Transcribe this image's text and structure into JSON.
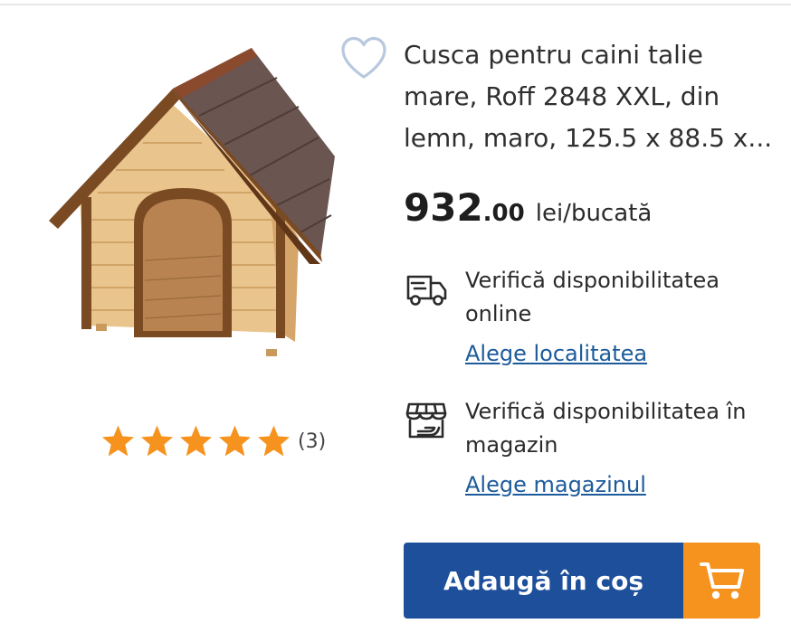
{
  "product": {
    "title": "Cusca pentru caini talie mare, Roff 2848 XXL, din lemn, maro, 125.5 x 88.5 x...",
    "image_icon": "dog-house-image",
    "rating": {
      "stars": 5,
      "max": 5,
      "count_label": "(3)"
    },
    "price": {
      "integer": "932",
      "decimals": ".00",
      "unit": "lei/bucată"
    }
  },
  "availability": {
    "online": {
      "icon": "delivery-truck-icon",
      "text": "Verifică disponibilitatea online",
      "link": "Alege localitatea"
    },
    "store": {
      "icon": "store-icon",
      "text": "Verifică disponibilitatea în magazin",
      "link": "Alege magazinul"
    }
  },
  "cart": {
    "button_label": "Adaugă în coș",
    "icon": "cart-icon"
  },
  "colors": {
    "primary": "#1e4f9b",
    "accent": "#f6921e",
    "star": "#f6921e",
    "link": "#1d5b9b",
    "wishlist": "#b8c8de"
  }
}
